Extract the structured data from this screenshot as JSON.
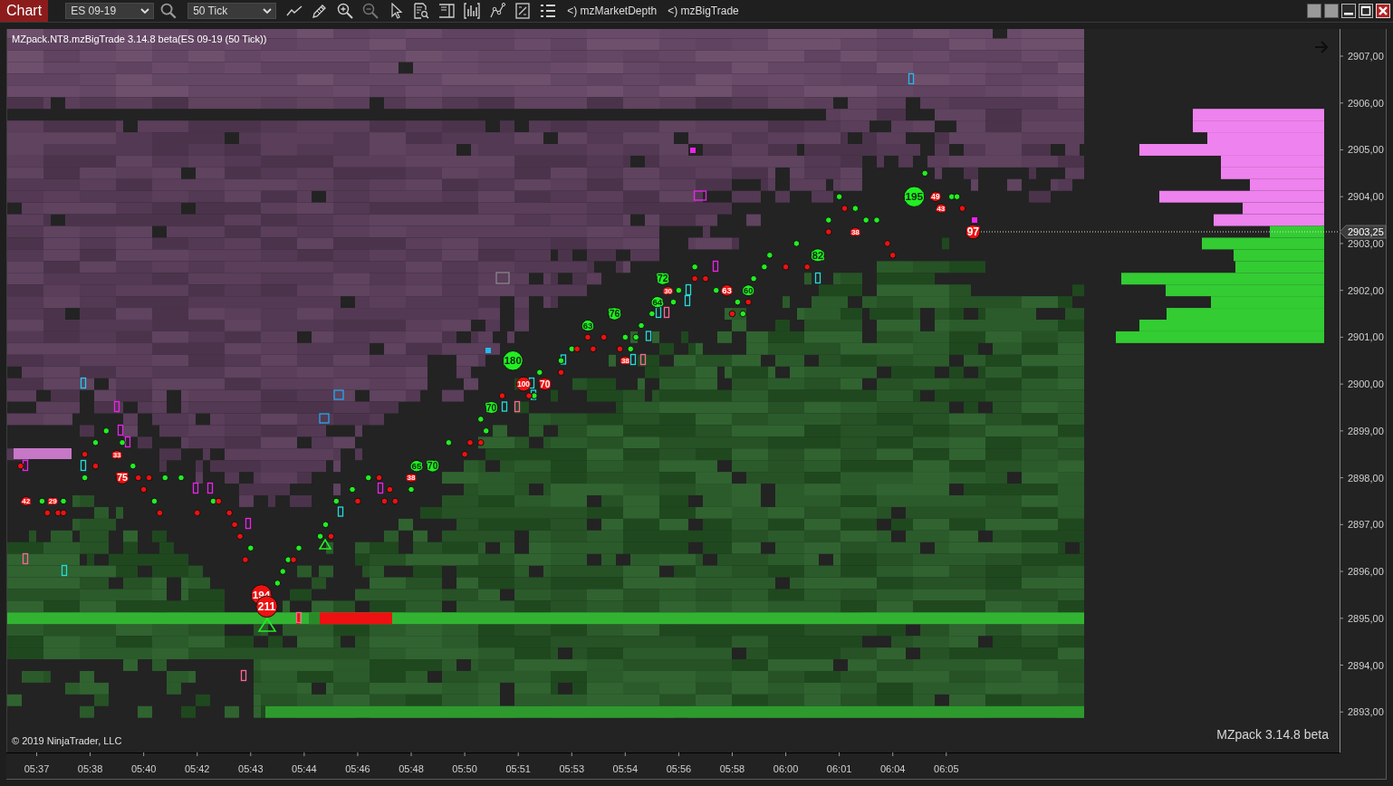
{
  "toolbar": {
    "tab": {
      "label": "Chart",
      "selected": true
    },
    "instrument": "ES 09-19",
    "interval": "50 Tick",
    "indicators": [
      "<) mzMarketDepth",
      "<) mzBigTrade"
    ]
  },
  "chart": {
    "title": "MZpack.NT8.mzBigTrade 3.14.8 beta(ES 09-19 (50 Tick))",
    "copyright": "© 2019 NinjaTrader, LLC",
    "version_label": "MZpack 3.14.8 beta",
    "last_price": "2903,25",
    "chart_data": {
      "type": "scatter",
      "ylim": [
        2892.135,
        2907.58
      ],
      "yticks": [
        {
          "value": 2907,
          "label": "2907,00"
        },
        {
          "value": 2906,
          "label": "2906,00"
        },
        {
          "value": 2905,
          "label": "2905,00"
        },
        {
          "value": 2904,
          "label": "2904,00"
        },
        {
          "value": 2903,
          "label": "2903,00"
        },
        {
          "value": 2902,
          "label": "2902,00"
        },
        {
          "value": 2901,
          "label": "2901,00"
        },
        {
          "value": 2900,
          "label": "2900,00"
        },
        {
          "value": 2899,
          "label": "2899,00"
        },
        {
          "value": 2898,
          "label": "2898,00"
        },
        {
          "value": 2897,
          "label": "2897,00"
        },
        {
          "value": 2896,
          "label": "2896,00"
        },
        {
          "value": 2895,
          "label": "2895,00"
        },
        {
          "value": 2894,
          "label": "2894,00"
        },
        {
          "value": 2893,
          "label": "2893,00"
        }
      ],
      "categories": [
        null,
        null,
        null,
        null,
        null,
        "05:37",
        null,
        null,
        null,
        null,
        null,
        null,
        null,
        null,
        null,
        "05:38",
        null,
        null,
        null,
        null,
        null,
        null,
        null,
        null,
        null,
        "05:40",
        null,
        null,
        null,
        null,
        null,
        null,
        null,
        null,
        null,
        "05:42",
        null,
        null,
        null,
        null,
        null,
        null,
        null,
        null,
        null,
        "05:43",
        null,
        null,
        null,
        null,
        null,
        null,
        null,
        null,
        null,
        "05:44",
        null,
        null,
        null,
        null,
        null,
        null,
        null,
        null,
        null,
        "05:46",
        null,
        null,
        null,
        null,
        null,
        null,
        null,
        null,
        null,
        "05:48",
        null,
        null,
        null,
        null,
        null,
        null,
        null,
        null,
        null,
        "05:50",
        null,
        null,
        null,
        null,
        null,
        null,
        null,
        null,
        null,
        "05:51",
        null,
        null,
        null,
        null,
        null,
        null,
        null,
        null,
        null,
        "05:53",
        null,
        null,
        null,
        null,
        null,
        null,
        null,
        null,
        null,
        "05:54",
        null,
        null,
        null,
        null,
        null,
        null,
        null,
        null,
        null,
        "05:56",
        null,
        null,
        null,
        null,
        null,
        null,
        null,
        null,
        null,
        "05:58",
        null,
        null,
        null,
        null,
        null,
        null,
        null,
        null,
        null,
        "06:00",
        null,
        null,
        null,
        null,
        null,
        null,
        null,
        null,
        null,
        "06:01",
        null,
        null,
        null,
        null,
        null,
        null,
        null,
        null,
        null,
        "06:04",
        null,
        null,
        null,
        null,
        null,
        null,
        null,
        null,
        null,
        "06:05",
        null,
        null,
        null,
        null,
        null,
        null,
        null,
        null,
        null,
        null,
        null,
        null,
        null,
        null,
        null,
        null,
        null,
        null,
        null,
        null,
        null,
        null,
        null,
        null,
        null,
        null,
        null,
        null,
        null,
        null,
        null,
        null,
        null,
        null,
        null,
        null,
        null,
        null,
        null,
        null,
        null,
        null,
        null,
        null,
        null,
        null,
        null,
        null,
        null,
        null,
        null,
        null,
        null,
        null,
        null,
        null,
        null,
        null,
        null,
        null,
        null,
        null,
        null,
        null,
        null,
        null,
        null,
        null,
        null,
        null,
        null,
        null,
        null
      ],
      "series": [
        {
          "color": "#22ee22",
          "values": [
            null,
            null,
            null,
            null,
            null,
            null,
            2897.5,
            null,
            null,
            null,
            2897.5,
            null,
            null,
            null,
            2898,
            null,
            2898.75,
            null,
            2899,
            null,
            null,
            2898.75,
            null,
            2898.25,
            null,
            null,
            null,
            2897.5,
            null,
            2898,
            null,
            null,
            2898,
            null,
            null,
            null,
            null,
            null,
            2897.5,
            null,
            null,
            null,
            null,
            null,
            null,
            2896.5,
            null,
            null,
            null,
            null,
            2895.75,
            2896,
            2896.25,
            null,
            2896.5,
            null,
            null,
            null,
            2896.75,
            2897,
            null,
            2897.5,
            null,
            null,
            2897.75,
            null,
            null,
            2898,
            null,
            null,
            null,
            null,
            null,
            null,
            null,
            2897.75,
            2898.25,
            null,
            null,
            2898.25,
            null,
            null,
            2898.75,
            null,
            null,
            null,
            null,
            null,
            2899.25,
            2899,
            2899.5,
            null,
            null,
            null,
            2900.5,
            null,
            null,
            null,
            2899.75,
            2900.25,
            null,
            null,
            null,
            2900.5,
            null,
            2900.75,
            null,
            null,
            2901.25,
            null,
            null,
            null,
            null,
            2901.5,
            null,
            2901,
            2900.75,
            2901,
            2901.25,
            null,
            2901.5,
            2901.75,
            2902.25,
            null,
            2901.75,
            2902,
            null,
            null,
            2902.5,
            null,
            null,
            null,
            2902,
            null,
            null,
            null,
            2901.75,
            2901.5,
            2902,
            2902.25,
            null,
            2902.5,
            2902.75,
            null,
            null,
            null,
            null,
            2903,
            null,
            null,
            null,
            2902.75,
            null,
            2903.5,
            null,
            2904,
            null,
            null,
            2903.75,
            null,
            2903.5,
            null,
            2903.5,
            null,
            null,
            null,
            null,
            null,
            null,
            2904,
            null,
            2904.5,
            null,
            null,
            null,
            null,
            2904,
            2904,
            null,
            null,
            null,
            null,
            null,
            null,
            null,
            null,
            null,
            null,
            null,
            null,
            null,
            null,
            null,
            null,
            null,
            null,
            null,
            null,
            null,
            null,
            null,
            null,
            null,
            null,
            null,
            null,
            null,
            null,
            null,
            null,
            null,
            null,
            null,
            null,
            null,
            null,
            null,
            null,
            null,
            null,
            null,
            null,
            null,
            null,
            null,
            null,
            null,
            null,
            null,
            null,
            null,
            null,
            null,
            null,
            null,
            null,
            null,
            null,
            null,
            null,
            null,
            null,
            null,
            null,
            null,
            null,
            null,
            null,
            null
          ],
          "sizes": [
            null,
            null,
            null,
            null,
            null,
            null,
            null,
            null,
            null,
            null,
            null,
            null,
            null,
            null,
            null,
            null,
            null,
            null,
            null,
            null,
            null,
            null,
            null,
            null,
            null,
            null,
            null,
            null,
            null,
            null,
            null,
            null,
            null,
            null,
            null,
            null,
            null,
            null,
            null,
            null,
            null,
            null,
            null,
            null,
            null,
            null,
            null,
            null,
            null,
            null,
            null,
            null,
            null,
            null,
            null,
            null,
            null,
            null,
            null,
            null,
            null,
            null,
            null,
            null,
            null,
            null,
            null,
            null,
            null,
            null,
            null,
            null,
            null,
            null,
            null,
            null,
            65,
            null,
            null,
            70,
            null,
            null,
            null,
            null,
            null,
            null,
            null,
            null,
            null,
            null,
            70,
            null,
            null,
            null,
            180,
            null,
            null,
            null,
            null,
            null,
            null,
            null,
            null,
            null,
            null,
            null,
            null,
            null,
            63,
            null,
            null,
            null,
            null,
            76,
            null,
            null,
            null,
            null,
            null,
            null,
            null,
            64,
            72,
            null,
            null,
            null,
            null,
            null,
            null,
            null,
            null,
            null,
            null,
            null,
            null,
            null,
            null,
            null,
            60,
            null,
            null,
            null,
            null,
            null,
            null,
            null,
            null,
            null,
            null,
            null,
            null,
            82,
            null,
            null,
            null,
            null,
            null,
            null,
            null,
            null,
            null,
            null,
            null,
            null,
            null,
            null,
            null,
            null,
            null,
            195,
            null,
            null,
            null,
            null,
            null,
            null,
            null,
            null,
            null,
            null,
            null,
            null,
            null,
            null,
            null,
            null,
            null,
            null,
            null,
            null,
            null,
            null,
            null,
            null,
            null,
            null,
            null,
            null,
            null,
            null,
            null,
            null,
            null,
            null,
            null,
            null,
            null,
            null,
            null,
            null,
            null,
            null,
            null,
            null,
            null,
            null,
            null,
            null,
            null,
            null,
            null,
            null,
            null,
            null,
            null,
            null,
            null,
            null,
            null,
            null,
            null,
            null,
            null,
            null,
            null,
            null,
            null,
            null,
            null,
            null,
            null,
            null,
            null,
            null,
            null,
            null,
            null,
            null,
            null
          ],
          "value_labels": [
            null,
            null,
            null,
            null,
            null,
            null,
            null,
            null,
            null,
            null,
            null,
            null,
            null,
            null,
            null,
            null,
            null,
            null,
            null,
            null,
            null,
            null,
            null,
            null,
            null,
            null,
            null,
            null,
            null,
            null,
            null,
            null,
            null,
            null,
            null,
            null,
            null,
            null,
            null,
            null,
            null,
            null,
            null,
            null,
            null,
            null,
            null,
            null,
            null,
            null,
            null,
            null,
            null,
            null,
            null,
            null,
            null,
            null,
            null,
            null,
            null,
            null,
            null,
            null,
            null,
            null,
            null,
            null,
            null,
            null,
            null,
            null,
            null,
            null,
            null,
            null,
            "65",
            null,
            null,
            "70",
            null,
            null,
            null,
            null,
            null,
            null,
            null,
            null,
            null,
            null,
            "70",
            null,
            null,
            null,
            "180",
            null,
            null,
            null,
            null,
            null,
            null,
            null,
            null,
            null,
            null,
            null,
            null,
            null,
            "63",
            null,
            null,
            null,
            null,
            "76",
            null,
            null,
            null,
            null,
            null,
            null,
            null,
            "64",
            "72",
            null,
            null,
            null,
            null,
            null,
            null,
            null,
            null,
            null,
            null,
            null,
            null,
            null,
            null,
            null,
            "60",
            null,
            null,
            null,
            null,
            null,
            null,
            null,
            null,
            null,
            null,
            null,
            null,
            "82",
            null,
            null,
            null,
            null,
            null,
            null,
            null,
            null,
            null,
            null,
            null,
            null,
            null,
            null,
            null,
            null,
            null,
            "195",
            null,
            null,
            null,
            null,
            null,
            null,
            null,
            null,
            null,
            null,
            null,
            null,
            null,
            null,
            null,
            null,
            null,
            null,
            null,
            null,
            null,
            null,
            null,
            null,
            null,
            null,
            null,
            null,
            null,
            null,
            null,
            null,
            null,
            null,
            null,
            null,
            null,
            null,
            null,
            null,
            null,
            null,
            null,
            null,
            null,
            null,
            null,
            null,
            null,
            null,
            null,
            null,
            null,
            null,
            null,
            null,
            null,
            null,
            null,
            null,
            null,
            null,
            null,
            null,
            null,
            null,
            null,
            null,
            null,
            null,
            null,
            null,
            null,
            null,
            null,
            null,
            null,
            null,
            null
          ]
        },
        {
          "color": "#ee1111",
          "values": [
            null,
            null,
            2898.25,
            2897.5,
            null,
            null,
            null,
            2897.25,
            2897.5,
            2897.25,
            2897.25,
            null,
            null,
            null,
            2898.5,
            null,
            2898.25,
            null,
            null,
            null,
            2898.5,
            2898,
            null,
            null,
            2898,
            2897.75,
            2898,
            null,
            2897.25,
            null,
            null,
            null,
            null,
            null,
            null,
            2897.25,
            null,
            null,
            null,
            2897.5,
            null,
            2897.25,
            2897,
            2896.75,
            2896.25,
            null,
            null,
            2895.5,
            2895.25,
            null,
            null,
            null,
            null,
            2896.25,
            null,
            null,
            null,
            null,
            null,
            null,
            2896.75,
            null,
            null,
            null,
            null,
            2897.5,
            null,
            null,
            null,
            2898,
            2897.5,
            2897.75,
            2897.5,
            null,
            null,
            2898,
            null,
            null,
            null,
            null,
            null,
            null,
            null,
            null,
            null,
            2898.5,
            2898.75,
            null,
            2898.75,
            null,
            null,
            null,
            2899.75,
            null,
            null,
            null,
            2900,
            2899.75,
            null,
            null,
            2900,
            null,
            null,
            2900.25,
            null,
            null,
            2900.75,
            null,
            2901,
            2900.75,
            null,
            2901,
            null,
            null,
            2900.75,
            2900.5,
            null,
            null,
            null,
            null,
            null,
            null,
            null,
            2902,
            null,
            null,
            null,
            null,
            2902.25,
            null,
            2902.25,
            null,
            null,
            null,
            2902,
            2901.5,
            null,
            null,
            2901.75,
            null,
            null,
            null,
            null,
            null,
            null,
            2902.5,
            null,
            null,
            null,
            2902.5,
            null,
            null,
            null,
            2903.25,
            null,
            null,
            2903.75,
            null,
            2903.25,
            null,
            null,
            null,
            null,
            null,
            2903,
            2902.75,
            null,
            null,
            null,
            null,
            null,
            null,
            null,
            2904,
            2903.75,
            null,
            null,
            null,
            2903.75,
            null,
            2903.25,
            null,
            null,
            null,
            null,
            null,
            null,
            null,
            null,
            null,
            null,
            null,
            null,
            null,
            null,
            null,
            null,
            null,
            null,
            null,
            null,
            null,
            null,
            null,
            null,
            null,
            null,
            null,
            null,
            null,
            null,
            null,
            null,
            null,
            null,
            null,
            null,
            null,
            null,
            null,
            null,
            null,
            null,
            null,
            null,
            null,
            null,
            null,
            null,
            null,
            null,
            null,
            null,
            null,
            null,
            null,
            null,
            null,
            null,
            null,
            null,
            null,
            null,
            null,
            null,
            null,
            null,
            null,
            null
          ],
          "sizes": [
            null,
            null,
            null,
            42,
            null,
            null,
            null,
            null,
            29,
            null,
            null,
            null,
            null,
            null,
            null,
            null,
            null,
            null,
            null,
            null,
            33,
            75,
            null,
            null,
            null,
            null,
            null,
            null,
            null,
            null,
            null,
            null,
            null,
            null,
            null,
            null,
            null,
            null,
            null,
            null,
            null,
            null,
            null,
            null,
            null,
            null,
            null,
            194,
            211,
            null,
            null,
            null,
            null,
            null,
            null,
            null,
            null,
            null,
            null,
            null,
            null,
            null,
            null,
            null,
            null,
            null,
            null,
            null,
            null,
            null,
            null,
            null,
            null,
            null,
            null,
            38,
            null,
            null,
            null,
            null,
            null,
            null,
            null,
            null,
            null,
            null,
            null,
            null,
            null,
            null,
            null,
            null,
            null,
            null,
            null,
            null,
            100,
            null,
            null,
            null,
            70,
            null,
            null,
            null,
            null,
            null,
            null,
            null,
            null,
            null,
            null,
            null,
            null,
            null,
            null,
            38,
            null,
            null,
            null,
            null,
            null,
            null,
            null,
            30,
            null,
            null,
            null,
            null,
            null,
            null,
            null,
            null,
            null,
            null,
            63,
            null,
            null,
            null,
            null,
            null,
            null,
            null,
            null,
            null,
            null,
            null,
            null,
            null,
            null,
            null,
            null,
            null,
            null,
            null,
            null,
            null,
            null,
            null,
            38,
            null,
            null,
            null,
            null,
            null,
            null,
            null,
            null,
            null,
            null,
            null,
            null,
            null,
            null,
            49,
            43,
            null,
            null,
            null,
            null,
            null,
            97,
            null,
            null,
            null,
            null,
            null,
            null,
            null,
            null,
            null,
            null,
            null,
            null,
            null,
            null,
            null,
            null,
            null,
            null,
            null,
            null,
            null,
            null,
            null,
            null,
            null,
            null,
            null,
            null,
            null,
            null,
            null,
            null,
            null,
            null,
            null,
            null,
            null,
            null,
            null,
            null,
            null,
            null,
            null,
            null,
            null,
            null,
            null,
            null,
            null,
            null,
            null,
            null,
            null,
            null,
            null,
            null,
            null,
            null,
            null,
            null,
            null,
            null,
            null,
            null,
            null,
            null,
            null,
            null
          ],
          "value_labels": [
            null,
            null,
            null,
            "42",
            null,
            null,
            null,
            null,
            "29",
            null,
            null,
            null,
            null,
            null,
            null,
            null,
            null,
            null,
            null,
            null,
            "33",
            "75",
            null,
            null,
            null,
            null,
            null,
            null,
            null,
            null,
            null,
            null,
            null,
            null,
            null,
            null,
            null,
            null,
            null,
            null,
            null,
            null,
            null,
            null,
            null,
            null,
            null,
            "194",
            "211",
            null,
            null,
            null,
            null,
            null,
            null,
            null,
            null,
            null,
            null,
            null,
            null,
            null,
            null,
            null,
            null,
            null,
            null,
            null,
            null,
            null,
            null,
            null,
            null,
            null,
            null,
            "38",
            null,
            null,
            null,
            null,
            null,
            null,
            null,
            null,
            null,
            null,
            null,
            null,
            null,
            null,
            null,
            null,
            null,
            null,
            null,
            null,
            "100",
            null,
            null,
            null,
            "70",
            null,
            null,
            null,
            null,
            null,
            null,
            null,
            null,
            null,
            null,
            null,
            null,
            null,
            null,
            "38",
            null,
            null,
            null,
            null,
            null,
            null,
            null,
            "30",
            null,
            null,
            null,
            null,
            null,
            null,
            null,
            null,
            null,
            null,
            "63",
            null,
            null,
            null,
            null,
            null,
            null,
            null,
            null,
            null,
            null,
            null,
            null,
            null,
            null,
            null,
            null,
            null,
            null,
            null,
            null,
            null,
            null,
            null,
            "38",
            null,
            null,
            null,
            null,
            null,
            null,
            null,
            null,
            null,
            null,
            null,
            null,
            null,
            null,
            "49",
            "43",
            null,
            null,
            null,
            null,
            null,
            "97",
            null,
            null,
            null,
            null,
            null,
            null,
            null,
            null,
            null,
            null,
            null,
            null,
            null,
            null,
            null,
            null,
            null,
            null,
            null,
            null,
            null,
            null,
            null,
            null,
            null,
            null,
            null,
            null,
            null,
            null,
            null,
            null,
            null,
            null,
            null,
            null,
            null,
            null,
            null,
            null,
            null,
            null,
            null,
            null,
            null,
            null,
            null,
            null,
            null,
            null,
            null,
            null,
            null,
            null,
            null,
            null,
            null,
            null,
            null,
            null,
            null,
            null,
            null,
            null,
            null,
            null,
            null,
            null
          ]
        }
      ]
    }
  }
}
